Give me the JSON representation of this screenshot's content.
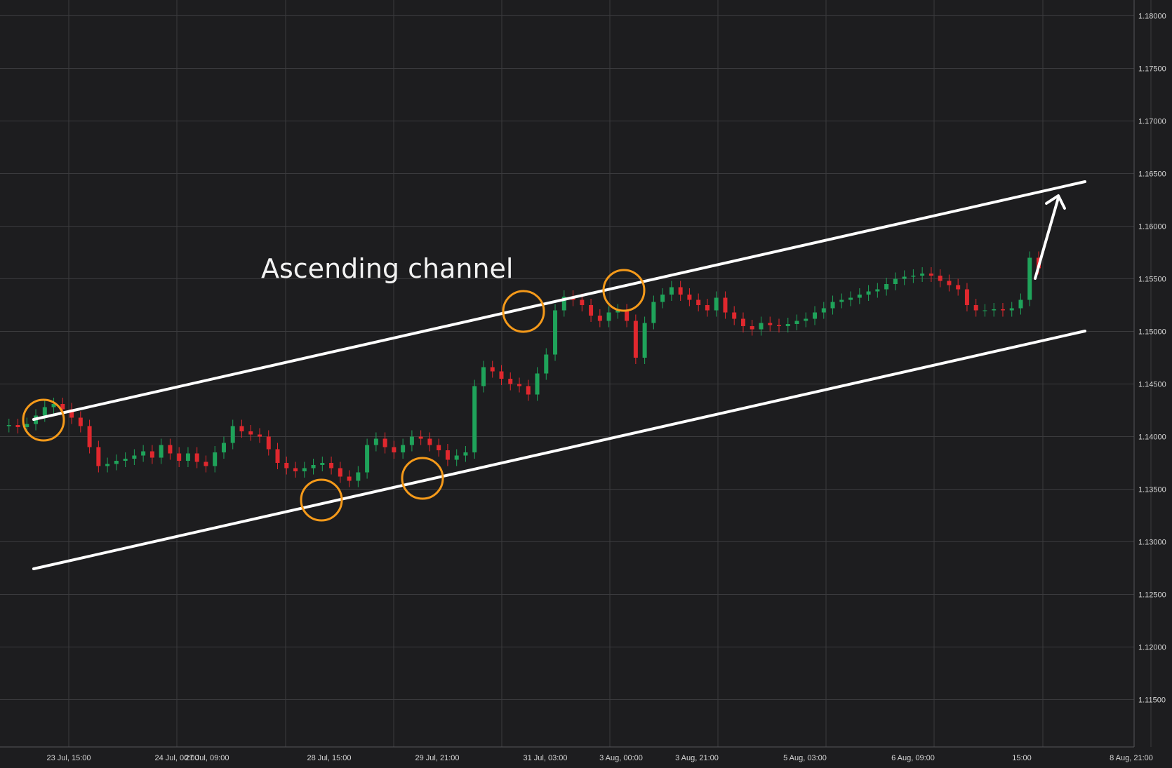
{
  "chart_data": {
    "type": "candlestick",
    "title": "",
    "xlabel": "",
    "ylabel": "",
    "ylim": [
      1.1105,
      1.1815
    ],
    "y_ticks": [
      "1.11500",
      "1.12000",
      "1.12500",
      "1.13000",
      "1.13500",
      "1.14000",
      "1.14500",
      "1.15000",
      "1.15500",
      "1.16000",
      "1.16500",
      "1.17000",
      "1.17500",
      "1.18000"
    ],
    "x_ticks": [
      "23 Jul, 15:00",
      "24 Jul, 00:00",
      "27 Jul, 09:00",
      "28 Jul, 15:00",
      "29 Jul, 21:00",
      "31 Jul, 03:00",
      "3 Aug, 00:00",
      "3 Aug, 21:00",
      "5 Aug, 03:00",
      "6 Aug, 09:00",
      "15:00",
      "8 Aug, 21:00"
    ],
    "x_label_order": [
      0,
      1,
      2,
      3,
      4,
      5,
      6,
      7,
      8,
      9,
      10,
      11
    ],
    "grid": true,
    "colors": {
      "background": "#1d1d1f",
      "grid": "#3b3b3e",
      "up": "#1fa35a",
      "down": "#e0282e",
      "channel": "#ffffff",
      "highlight": "#f59a1a"
    },
    "price_path": [
      1.141,
      1.1411,
      1.1409,
      1.1412,
      1.142,
      1.1428,
      1.1431,
      1.1426,
      1.1418,
      1.141,
      1.139,
      1.1372,
      1.1374,
      1.1377,
      1.1379,
      1.1382,
      1.1386,
      1.138,
      1.1392,
      1.1384,
      1.1377,
      1.1384,
      1.1376,
      1.1372,
      1.1385,
      1.1394,
      1.141,
      1.1405,
      1.1402,
      1.14,
      1.1388,
      1.1375,
      1.137,
      1.1367,
      1.137,
      1.1373,
      1.1375,
      1.137,
      1.1362,
      1.1358,
      1.1366,
      1.1392,
      1.1398,
      1.139,
      1.1385,
      1.1392,
      1.14,
      1.1398,
      1.1392,
      1.1387,
      1.1378,
      1.1382,
      1.1385,
      1.1448,
      1.1466,
      1.1462,
      1.1455,
      1.145,
      1.1448,
      1.144,
      1.146,
      1.1478,
      1.152,
      1.1533,
      1.153,
      1.1525,
      1.1515,
      1.151,
      1.1518,
      1.152,
      1.151,
      1.1475,
      1.1508,
      1.1528,
      1.1535,
      1.1542,
      1.1535,
      1.153,
      1.1525,
      1.152,
      1.1532,
      1.1518,
      1.1512,
      1.1505,
      1.1502,
      1.1508,
      1.1506,
      1.1505,
      1.1507,
      1.151,
      1.1512,
      1.1518,
      1.1522,
      1.1528,
      1.153,
      1.1532,
      1.1535,
      1.1538,
      1.154,
      1.1545,
      1.155,
      1.1552,
      1.1553,
      1.1555,
      1.1553,
      1.1548,
      1.1544,
      1.154,
      1.1525,
      1.152,
      1.152,
      1.1521,
      1.152,
      1.1522,
      1.153,
      1.157,
      1.156
    ],
    "annotations": {
      "text": "Ascending channel",
      "upper_channel": {
        "from": [
          0,
          1.1432
        ],
        "to": [
          122,
          1.1658
        ]
      },
      "lower_channel": {
        "from": [
          0,
          1.1291
        ],
        "to": [
          122,
          1.1517
        ]
      },
      "touch_points": [
        {
          "index": 5,
          "price": 1.143
        },
        {
          "index": 36,
          "price": 1.1362
        },
        {
          "index": 48,
          "price": 1.1382
        },
        {
          "index": 60,
          "price": 1.1535
        },
        {
          "index": 71,
          "price": 1.1555
        }
      ],
      "arrow": {
        "from": [
          118,
          1.1563
        ],
        "to": [
          121,
          1.165
        ]
      }
    }
  }
}
